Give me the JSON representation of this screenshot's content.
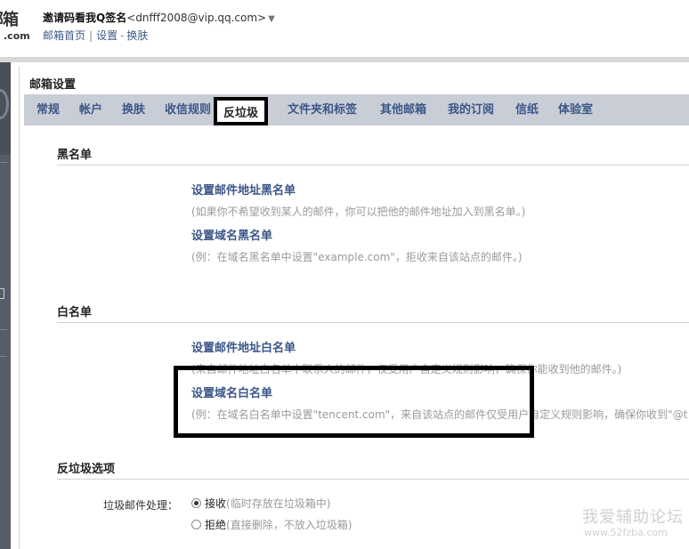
{
  "header": {
    "logo_text": "邮箱",
    "logo_suffix": ".com",
    "nickname": "邀请码看我Q签名",
    "email": "<dnfff2008@vip.qq.com>",
    "caret": "▼",
    "links": [
      "邮箱首页",
      "设置",
      "换肤"
    ],
    "link_sep": "|",
    "link_dash": "-"
  },
  "panel": {
    "title": "邮箱设置",
    "tabs": [
      "常规",
      "帐户",
      "换肤",
      "收信规则",
      "反垃圾",
      "文件夹和标签",
      "其他邮箱",
      "我的订阅",
      "信纸",
      "体验室"
    ],
    "active_tab_index": 4
  },
  "blacklist": {
    "title": "黑名单",
    "email_title": "设置邮件地址黑名单",
    "email_desc": "(如果你不希望收到某人的邮件，你可以把他的邮件地址加入到黑名单。)",
    "domain_title": "设置域名黑名单",
    "domain_desc": "(例：在域名黑名单中设置\"example.com\"，拒收来自该站点的邮件。)"
  },
  "whitelist": {
    "title": "白名单",
    "email_title": "设置邮件地址白名单",
    "email_desc": "(来自邮件地址白名单中联系人的邮件，仅受用户自定义规则影响，确保你能收到他的邮件。)",
    "domain_title": "设置域名白名单",
    "domain_desc": "(例：在域名白名单中设置\"tencent.com\"，来自该站点的邮件仅受用户自定义规则影响，确保你收到\"@t"
  },
  "antispam": {
    "title": "反垃圾选项",
    "label": "垃圾邮件处理：",
    "options": [
      {
        "label": "接收",
        "hint": "(临时存放在垃圾箱中)",
        "checked": true
      },
      {
        "label": "拒绝",
        "hint": "(直接删除，不放入垃圾箱)",
        "checked": false
      }
    ]
  },
  "watermark": {
    "line1": "我爱辅助论坛",
    "line2": "www.52fzba.com"
  },
  "colors": {
    "link": "#3b5688",
    "tab_bar": "#c9ced6",
    "sidebar": "#565d68",
    "muted": "#9a9a9a",
    "highlight": "#000000"
  }
}
